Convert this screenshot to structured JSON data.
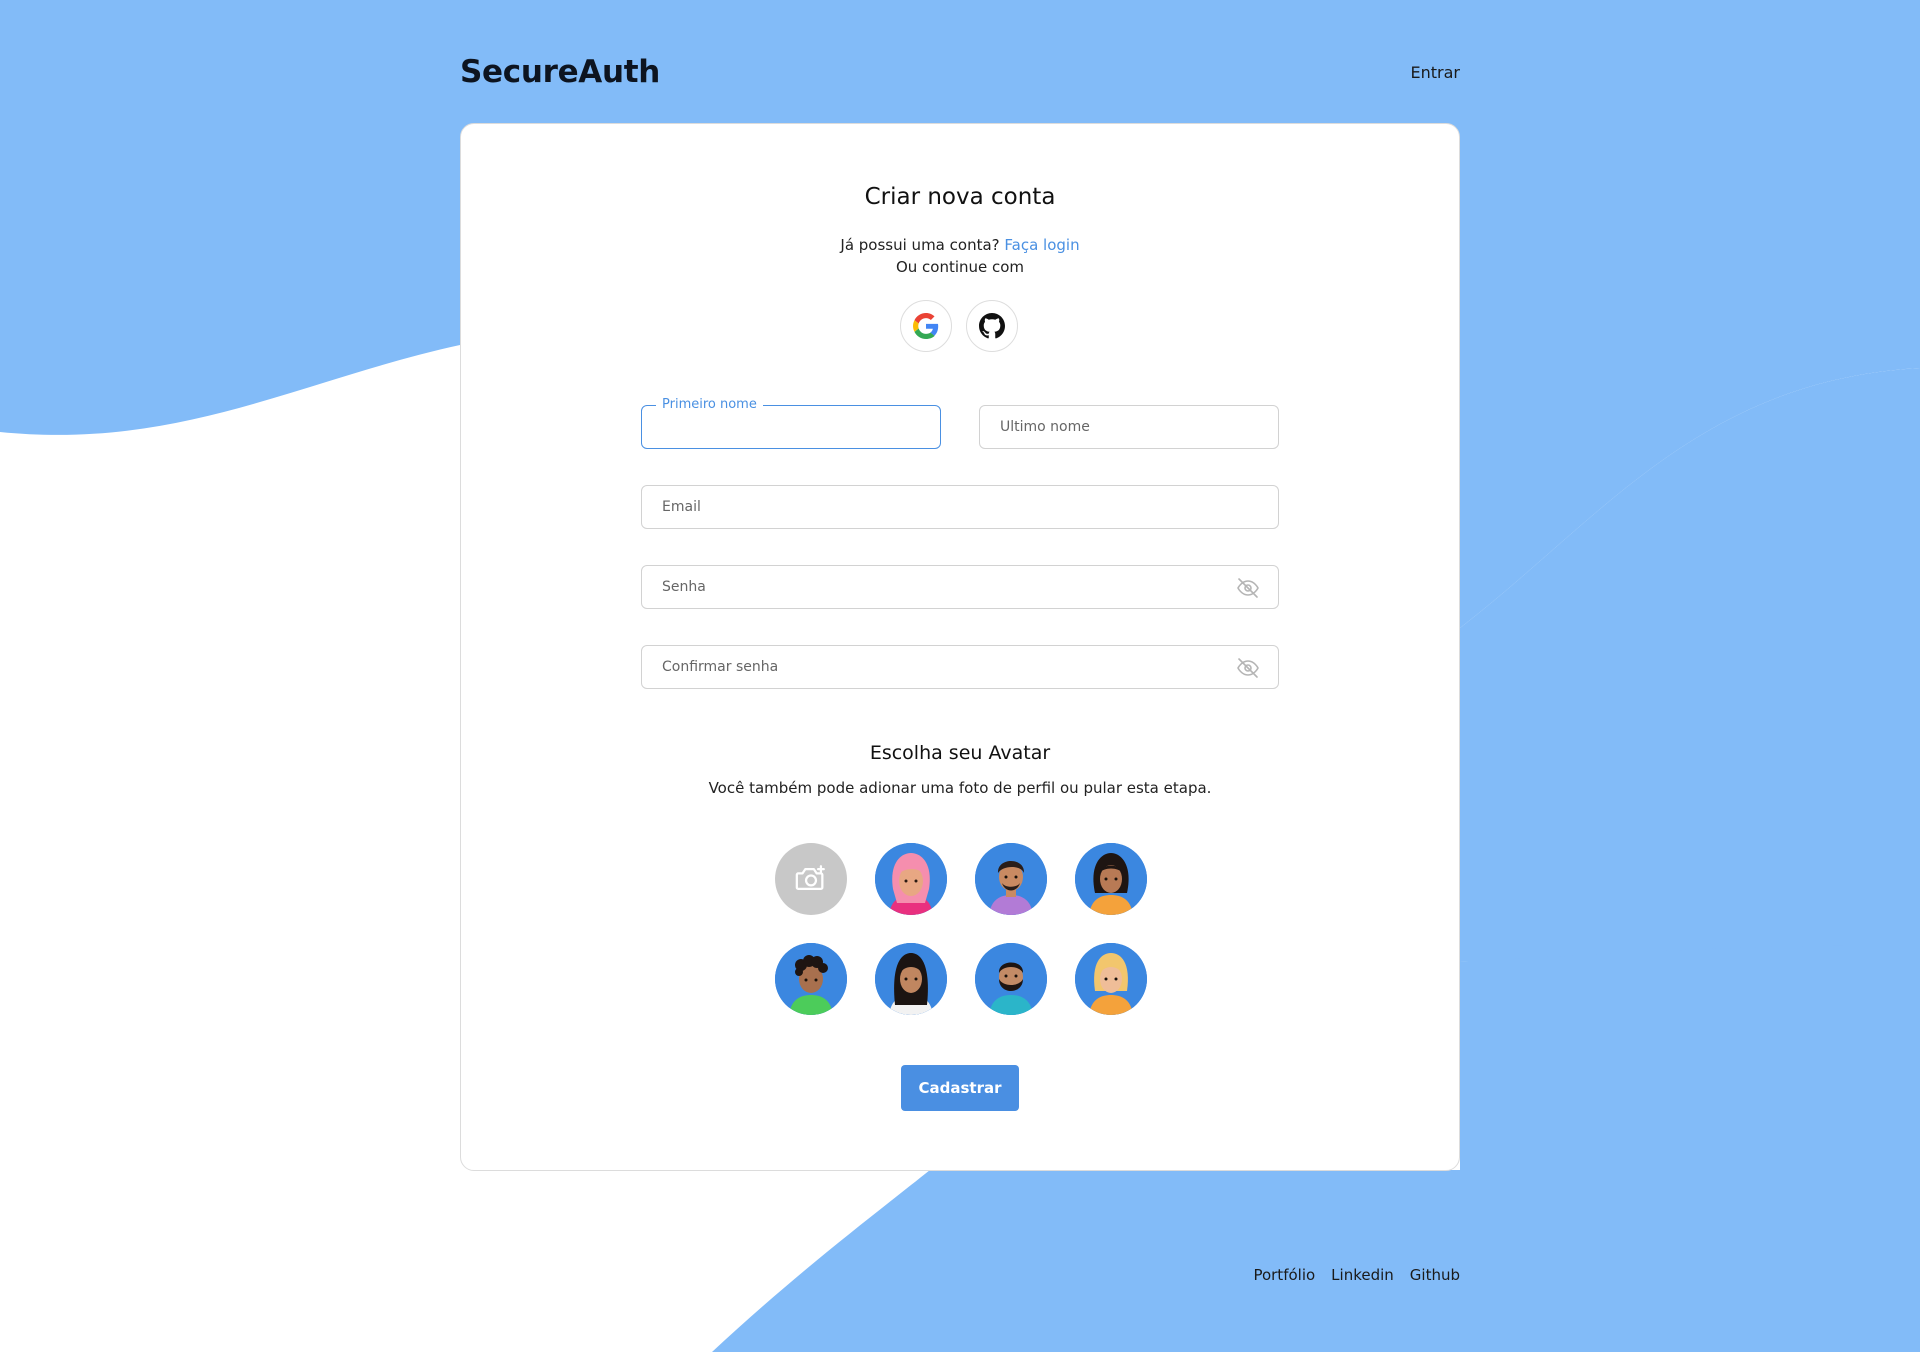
{
  "header": {
    "brand": "SecureAuth",
    "login_link": "Entrar"
  },
  "card": {
    "title": "Criar nova conta",
    "already_text": "Já possui uma conta?",
    "login_link": "Faça login",
    "continue_text": "Ou continue com"
  },
  "social": [
    {
      "name": "google",
      "icon": "google-icon"
    },
    {
      "name": "github",
      "icon": "github-icon"
    }
  ],
  "form": {
    "first_name_label": "Primeiro nome",
    "first_name_value": "",
    "last_name_placeholder": "Ultimo nome",
    "email_placeholder": "Email",
    "password_placeholder": "Senha",
    "confirm_password_placeholder": "Confirmar senha",
    "submit_label": "Cadastrar"
  },
  "avatar_section": {
    "title": "Escolha seu Avatar",
    "subtitle": "Você também pode adionar uma foto de perfil ou pular esta etapa."
  },
  "footer": {
    "links": [
      "Portfólio",
      "Linkedin",
      "Github"
    ]
  },
  "colors": {
    "accent": "#4a90e2",
    "wave_blue": "#82bbf8",
    "avatar_bg": "#3b87e0"
  }
}
